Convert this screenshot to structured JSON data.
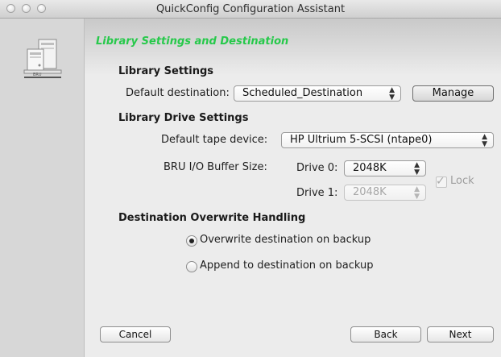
{
  "window": {
    "title": "QuickConfig Configuration Assistant"
  },
  "sidebar": {
    "icon": "tape-library-icon"
  },
  "page": {
    "heading": "Library Settings and Destination"
  },
  "library_settings": {
    "section_label": "Library Settings",
    "default_destination_label": "Default destination:",
    "default_destination_value": "Scheduled_Destination",
    "manage_label": "Manage"
  },
  "drive_settings": {
    "section_label": "Library Drive Settings",
    "default_tape_device_label": "Default tape device:",
    "default_tape_device_value": "HP Ultrium 5-SCSI (ntape0)",
    "buffer_size_label": "BRU I/O Buffer Size:",
    "drive0_label": "Drive 0:",
    "drive0_value": "2048K",
    "drive1_label": "Drive 1:",
    "drive1_value": "2048K",
    "lock_label": "Lock",
    "lock_checked": true
  },
  "overwrite": {
    "section_label": "Destination Overwrite Handling",
    "options": [
      {
        "label": "Overwrite destination on backup",
        "selected": true
      },
      {
        "label": "Append to destination on backup",
        "selected": false
      }
    ]
  },
  "buttons": {
    "cancel": "Cancel",
    "back": "Back",
    "next": "Next"
  },
  "colors": {
    "heading": "#27c94b"
  }
}
